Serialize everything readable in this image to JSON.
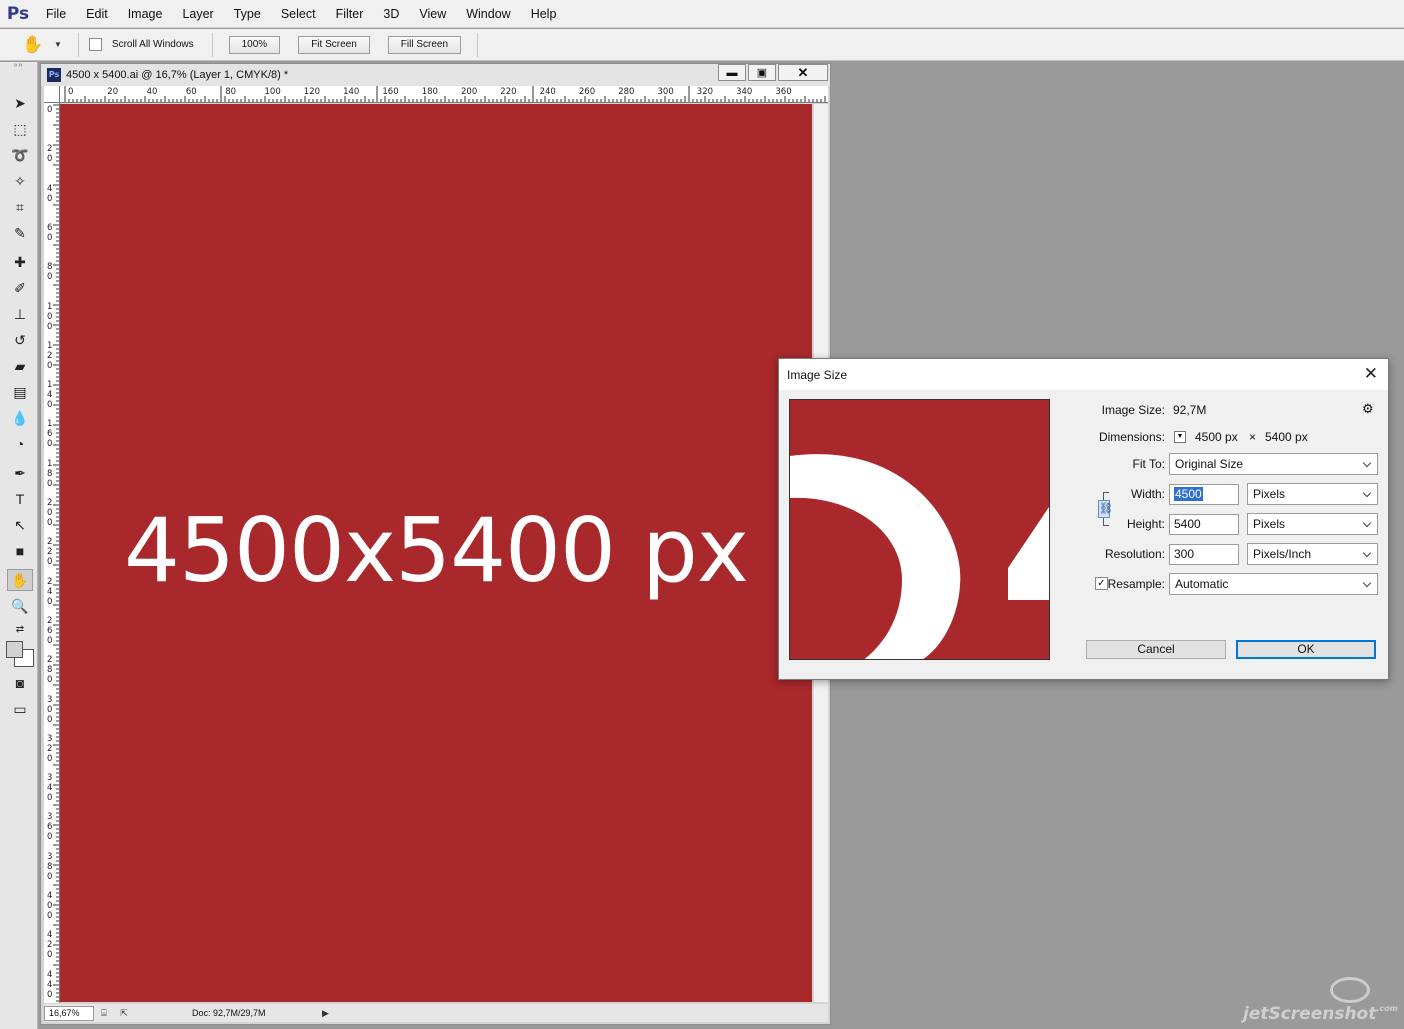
{
  "app": {
    "logo": "Ps"
  },
  "menu": [
    "File",
    "Edit",
    "Image",
    "Layer",
    "Type",
    "Select",
    "Filter",
    "3D",
    "View",
    "Window",
    "Help"
  ],
  "options_bar": {
    "tool_icon": "hand-icon",
    "scroll_all_label": "Scroll All Windows",
    "zoom_100": "100%",
    "fit_screen": "Fit Screen",
    "fill_screen": "Fill Screen"
  },
  "document": {
    "title": "4500 x 5400.ai @ 16,7% (Layer 1, CMYK/8) *",
    "canvas_text": "4500x5400 px",
    "canvas_color": "#a8282c",
    "ruler_top": [
      "0",
      "20",
      "40",
      "60",
      "80",
      "100",
      "120",
      "140",
      "160",
      "180",
      "200",
      "220",
      "240",
      "260",
      "280",
      "300",
      "320",
      "340",
      "360"
    ],
    "ruler_left": [
      "0",
      "2\n0",
      "4\n0",
      "6\n0",
      "8\n0",
      "1\n0\n0",
      "1\n2\n0",
      "1\n4\n0",
      "1\n6\n0",
      "1\n8\n0",
      "2\n0\n0",
      "2\n2\n0",
      "2\n4\n0",
      "2\n6\n0",
      "2\n8\n0",
      "3\n0\n0",
      "3\n2\n0",
      "3\n4\n0",
      "3\n6\n0",
      "3\n8\n0",
      "4\n0\n0",
      "4\n2\n0",
      "4\n4\n0"
    ],
    "zoom": "16,67%",
    "doc_size": "Doc: 92,7M/29,7M"
  },
  "dialog": {
    "title": "Image Size",
    "image_size_label": "Image Size:",
    "image_size_value": "92,7M",
    "dimensions_label": "Dimensions:",
    "dim_width": "4500 px",
    "dim_x": "×",
    "dim_height": "5400 px",
    "fit_to_label": "Fit To:",
    "fit_to_value": "Original Size",
    "width_label": "Width:",
    "width_value": "4500",
    "width_unit": "Pixels",
    "height_label": "Height:",
    "height_value": "5400",
    "height_unit": "Pixels",
    "resolution_label": "Resolution:",
    "resolution_value": "300",
    "resolution_unit": "Pixels/Inch",
    "resample_label": "Resample:",
    "resample_checked": true,
    "resample_value": "Automatic",
    "cancel": "Cancel",
    "ok": "OK"
  },
  "watermark": {
    "text": "jetScreenshot",
    "domain": ".com"
  }
}
